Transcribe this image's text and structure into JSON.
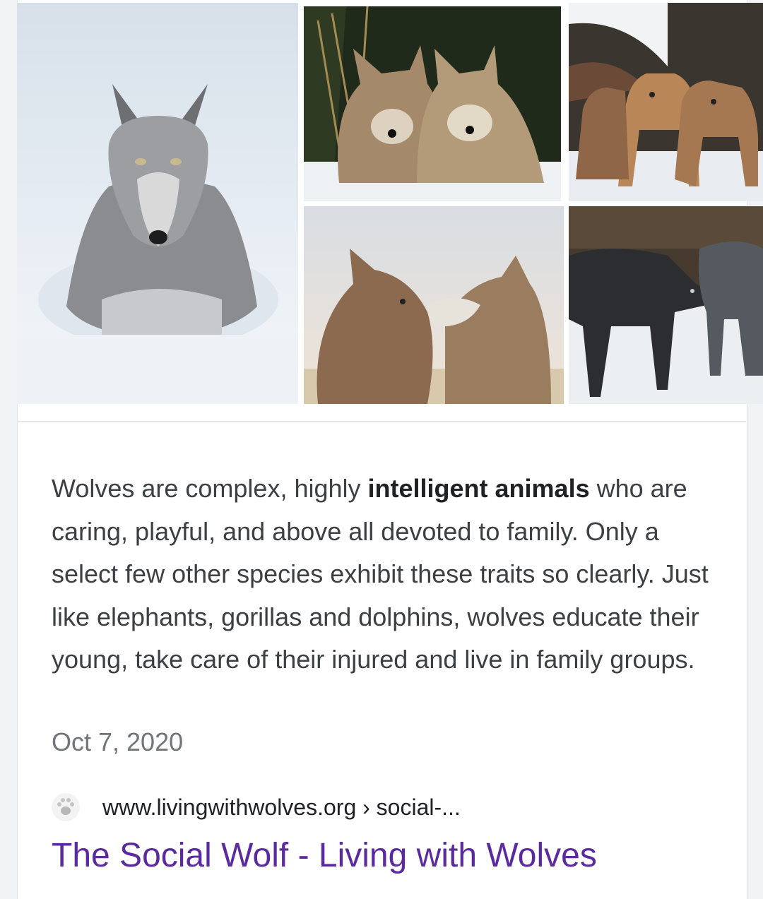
{
  "images": [
    {
      "alt": "grey wolf lying in snow"
    },
    {
      "alt": "two wolves together"
    },
    {
      "alt": "wolf pack in snow"
    },
    {
      "alt": "two wolves greeting"
    },
    {
      "alt": "dark wolves walking in snow"
    }
  ],
  "snippet": {
    "text_before": "Wolves are complex, highly ",
    "bold": "intelligent animals",
    "text_after": " who are caring, playful, and above all devoted to family. Only a select few other species exhibit these traits so clearly. Just like elephants, gorillas and dolphins, wolves educate their young, take care of their injured and live in family groups."
  },
  "date": "Oct 7, 2020",
  "source": {
    "favicon": "paw-print-icon",
    "url": "www.livingwithwolves.org › social-..."
  },
  "result": {
    "title": "The Social Wolf - Living with Wolves",
    "link_color": "#5a2a9e"
  }
}
